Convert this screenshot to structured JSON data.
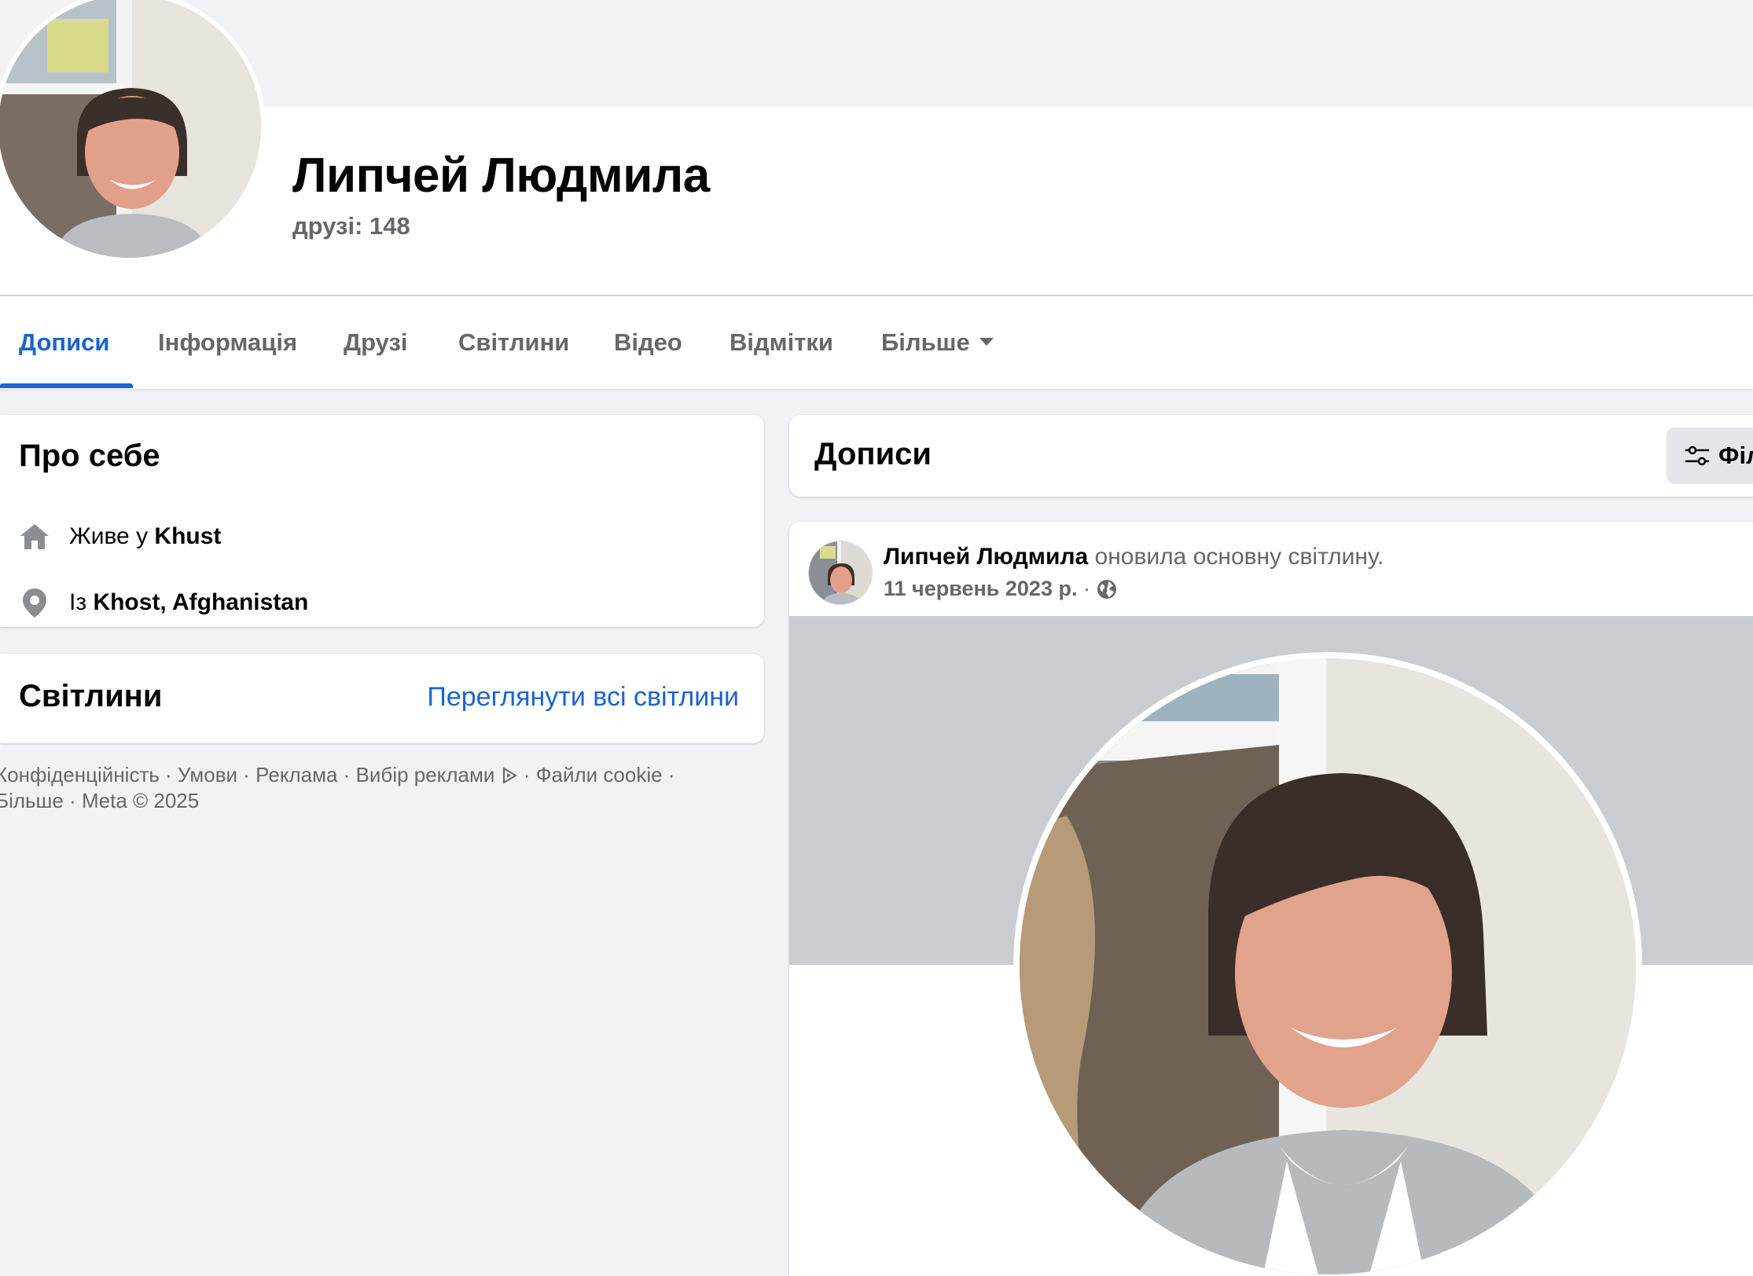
{
  "profile": {
    "name": "Липчей Людмила",
    "friends": "друзі: 148"
  },
  "tabs": [
    {
      "label": "Дописи",
      "active": true
    },
    {
      "label": "Інформація"
    },
    {
      "label": "Друзі"
    },
    {
      "label": "Світлини"
    },
    {
      "label": "Відео"
    },
    {
      "label": "Відмітки"
    },
    {
      "label": "Більше"
    }
  ],
  "intro": {
    "title": "Про себе",
    "lives_prefix": "Живе у",
    "lives_city": "Khust",
    "from_prefix": "Із",
    "from_place": "Khost, Afghanistan"
  },
  "photos": {
    "title": "Світлини",
    "see_all": "Переглянути всі світлини"
  },
  "footer": {
    "privacy": "Конфіденційність",
    "terms": "Умови",
    "ads": "Реклама",
    "ad_choices": "Вибір реклами",
    "cookies": "Файли cookie",
    "more": "Більше",
    "copyright": "Meta © 2025"
  },
  "posts_header": {
    "title": "Дописи",
    "filter_label": "Фільтри"
  },
  "post": {
    "author": "Липчей Людмила",
    "action": "оновила основну світлину.",
    "date": "11 червень 2023 р.",
    "separator": "·",
    "audience_icon": "globe-icon"
  },
  "colors": {
    "accent": "#1b64d1",
    "background": "#f0f2f5",
    "secondary_text": "#65676b"
  }
}
